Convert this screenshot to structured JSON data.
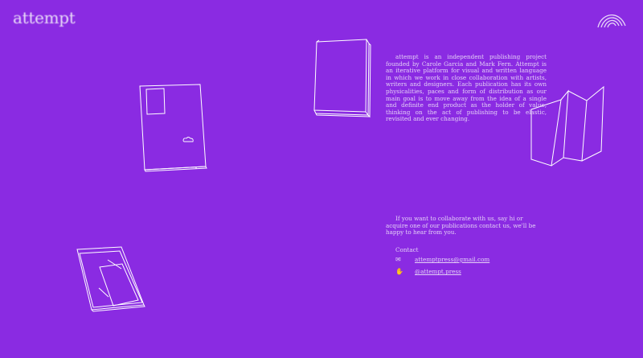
{
  "brand": {
    "logo_text": "attempt"
  },
  "about": {
    "text": "attempt is an independent publishing project founded by Carole Garcia and Mark Fern. Attempt is an iterative platform for visual and written language in which we work in close collaboration with artists, writers and designers. Each publication has its own physicalities, paces and form of distribution as our main goal is to move away from the idea of a single and definite end product as the holder of value, thinking on the act of publishing to be elastic, revisited and ever changing."
  },
  "collaborate": {
    "text": "If you want to collaborate with us, say hi or acquire one of our publications contact us, we'll be happy to hear from you."
  },
  "contact": {
    "label": "Contact",
    "email": "attemptpress@gmail.com",
    "instagram": "@attempt.press"
  },
  "icons": {
    "menu": "rainbow-arc-icon",
    "email": "envelope-icon",
    "instagram": "hand-icon"
  },
  "colors": {
    "background": "#8a2be2",
    "line": "#ffffff",
    "text": "#e4d0f6"
  }
}
